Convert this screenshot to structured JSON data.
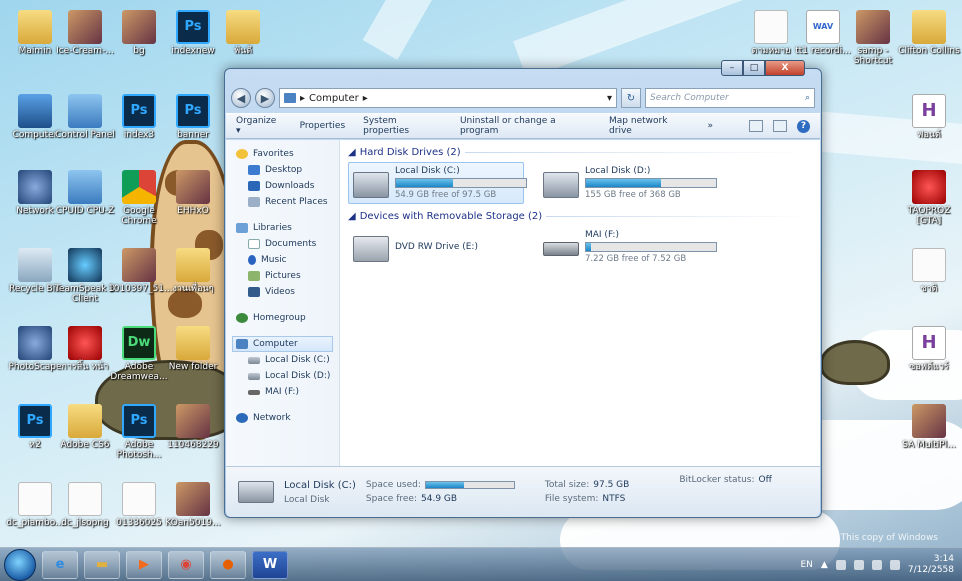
{
  "desktop": {
    "icons_left": [
      {
        "label": "Maimin",
        "glyph": "folder"
      },
      {
        "label": "Ice-Cream-...",
        "glyph": "img"
      },
      {
        "label": "bg",
        "glyph": "img"
      },
      {
        "label": "indexnew",
        "glyph": "ps"
      },
      {
        "label": "ฟันดี",
        "glyph": "folder"
      },
      {
        "label": "Computer",
        "glyph": "pc"
      },
      {
        "label": "Control Panel",
        "glyph": "cp"
      },
      {
        "label": "index3",
        "glyph": "ps"
      },
      {
        "label": "banner",
        "glyph": "ps"
      },
      {
        "label": "Network",
        "glyph": "net"
      },
      {
        "label": "CPUID CPU-Z",
        "glyph": "cp"
      },
      {
        "label": "Google Chrome",
        "glyph": "chrome"
      },
      {
        "label": "EHHxO",
        "glyph": "img"
      },
      {
        "label": "Recycle Bin",
        "glyph": "bin"
      },
      {
        "label": "TeamSpeak 3 Client",
        "glyph": "ts"
      },
      {
        "label": "1010397_51...",
        "glyph": "img"
      },
      {
        "label": "งานเพื่อนๆ",
        "glyph": "folder"
      },
      {
        "label": "PhotoScape",
        "glyph": "net"
      },
      {
        "label": "การสิ้น หน้า",
        "glyph": "red"
      },
      {
        "label": "Adobe Dreamwea...",
        "glyph": "dw"
      },
      {
        "label": "New folder",
        "glyph": "folder"
      },
      {
        "label": "ห2",
        "glyph": "ps"
      },
      {
        "label": "Adobe CS6",
        "glyph": "folder"
      },
      {
        "label": "Adobe Photosh...",
        "glyph": "ps"
      },
      {
        "label": "110468229",
        "glyph": "img"
      },
      {
        "label": "dc_piambo...",
        "glyph": "doc"
      },
      {
        "label": "dc_jlsopng",
        "glyph": "doc"
      },
      {
        "label": "01336025",
        "glyph": "img"
      },
      {
        "label": "KOan5019...",
        "glyph": "img"
      }
    ],
    "icons_right": [
      {
        "label": "ตามหมาย",
        "glyph": "doc"
      },
      {
        "label": "tt1 recordi...",
        "glyph": "wav"
      },
      {
        "label": "samp - Shortcut",
        "glyph": "img"
      },
      {
        "label": "Clifton Collins",
        "glyph": "folder"
      },
      {
        "label": "ฟอนต์",
        "glyph": "h"
      },
      {
        "label": "TAOPROZ [GTA]",
        "glyph": "red"
      },
      {
        "label": "ชาติ",
        "glyph": "doc"
      },
      {
        "label": "ซอฟต์แวร์",
        "glyph": "h"
      },
      {
        "label": "SA MultiPl...",
        "glyph": "img"
      }
    ],
    "watermark": "This copy of Windows"
  },
  "explorer": {
    "address": {
      "breadcrumb": "Computer",
      "arrow": "▸",
      "search_placeholder": "Search Computer"
    },
    "window_buttons": {
      "minimize": "–",
      "maximize": "□",
      "close": "X"
    },
    "toolbar": {
      "organize": "Organize ▾",
      "properties": "Properties",
      "system_properties": "System properties",
      "uninstall": "Uninstall or change a program",
      "map_drive": "Map network drive",
      "more": "»",
      "help": "?"
    },
    "nav": {
      "favorites": "Favorites",
      "desktop": "Desktop",
      "downloads": "Downloads",
      "recent": "Recent Places",
      "libraries": "Libraries",
      "documents": "Documents",
      "music": "Music",
      "pictures": "Pictures",
      "videos": "Videos",
      "homegroup": "Homegroup",
      "computer": "Computer",
      "disk_c": "Local Disk (C:)",
      "disk_d": "Local Disk (D:)",
      "mai_f": "MAI (F:)",
      "network": "Network"
    },
    "groups": {
      "hdd": "Hard Disk Drives (2)",
      "removable": "Devices with Removable Storage (2)"
    },
    "drives": [
      {
        "name": "Local Disk (C:)",
        "free_text": "54.9 GB free of 97.5 GB",
        "used_fraction": 0.437
      },
      {
        "name": "Local Disk (D:)",
        "free_text": "155 GB free of 368 GB",
        "used_fraction": 0.579
      },
      {
        "name": "DVD RW Drive (E:)"
      },
      {
        "name": "MAI (F:)",
        "free_text": "7.22 GB free of 7.52 GB",
        "used_fraction": 0.04
      }
    ],
    "details": {
      "name": "Local Disk (C:)",
      "type": "Local Disk",
      "space_used_label": "Space used:",
      "space_free_label": "Space free:",
      "space_free": "54.9 GB",
      "total_size_label": "Total size:",
      "total_size": "97.5 GB",
      "fs_label": "File system:",
      "fs": "NTFS",
      "bitlocker_label": "BitLocker status:",
      "bitlocker": "Off",
      "used_fraction": 0.437
    }
  },
  "taskbar": {
    "language": "EN",
    "time": "3:14",
    "date": "7/12/2558"
  }
}
